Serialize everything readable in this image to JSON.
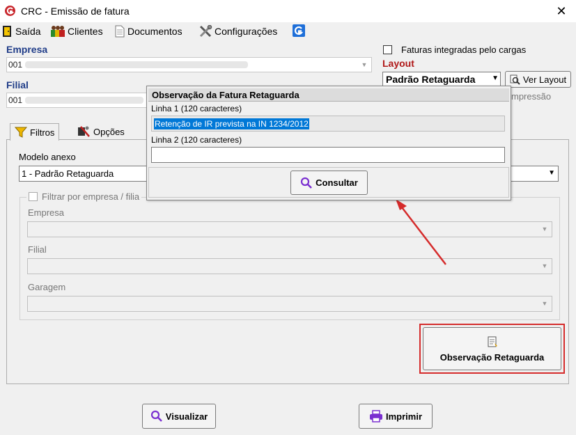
{
  "window": {
    "title": "CRC - Emissão de fatura",
    "close_label": "✕"
  },
  "toolbar": {
    "exit_label": "Saída",
    "clients_label": "Clientes",
    "documents_label": "Documentos",
    "settings_label": "Configurações"
  },
  "company": {
    "label": "Empresa",
    "value": "001"
  },
  "branch": {
    "label": "Filial",
    "value": "001"
  },
  "integrated": {
    "label": "Faturas integradas pelo cargas",
    "checked": false
  },
  "layout": {
    "label": "Layout",
    "selected": "Padrão Retaguarda",
    "view_button": "Ver Layout",
    "print_fragment": "mpressão"
  },
  "tabs": {
    "filters_label": "Filtros",
    "options_label": "Opções"
  },
  "model": {
    "label": "Modelo anexo",
    "selected": "1 - Padrão Retaguarda"
  },
  "filter": {
    "checkbox_label": "Filtrar por empresa / filia",
    "company_label": "Empresa",
    "branch_label": "Filial",
    "garage_label": "Garagem"
  },
  "observation_button": "Observação Retaguarda",
  "footer": {
    "view_button": "Visualizar",
    "print_button": "Imprimir"
  },
  "popup": {
    "title": "Observação da Fatura Retaguarda",
    "line1_label": "Linha 1 (120 caracteres)",
    "line1_value": "Retenção de IR prevista na IN 1234/2012",
    "line2_label": "Linha 2 (120 caracteres)",
    "line2_value": "",
    "consult_button": "Consultar"
  },
  "colors": {
    "label_blue": "#1f3c88",
    "layout_red": "#b01818",
    "highlight_red": "#d52b2b",
    "selection_blue": "#0078d7",
    "search_purple": "#7a2fd0"
  },
  "icons": {
    "app": "crc-logo-icon",
    "exit": "door-exit-icon",
    "clients": "people-icon",
    "documents": "document-icon",
    "settings": "tools-icon",
    "help": "g-app-icon",
    "filters": "funnel-icon",
    "options": "options-tools-icon",
    "search": "magnifier-icon",
    "print": "printer-icon",
    "observation": "note-icon"
  }
}
